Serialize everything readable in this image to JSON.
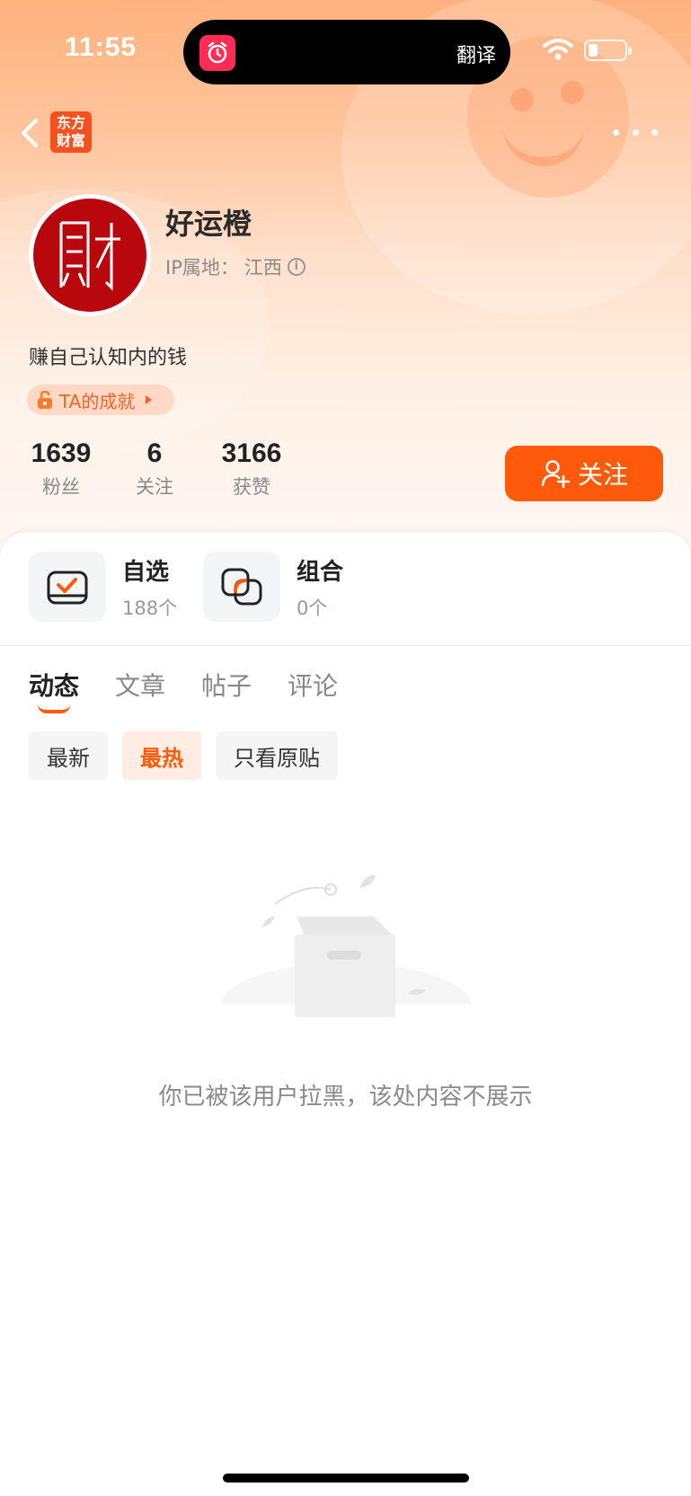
{
  "status_bar": {
    "time": "11:55",
    "island_label": "翻译"
  },
  "nav": {
    "logo_text_line1": "东方",
    "logo_text_line2": "财富"
  },
  "profile": {
    "name": "好运橙",
    "ip_label": "IP属地：",
    "ip_location": "江西",
    "bio": "赚自己认知内的钱",
    "achievement": "TA的成就"
  },
  "stats": [
    {
      "value": "1639",
      "label": "粉丝"
    },
    {
      "value": "6",
      "label": "关注"
    },
    {
      "value": "3166",
      "label": "获赞"
    }
  ],
  "follow_button": "关注",
  "features": [
    {
      "title": "自选",
      "count": "188个"
    },
    {
      "title": "组合",
      "count": "0个"
    }
  ],
  "tabs": [
    "动态",
    "文章",
    "帖子",
    "评论"
  ],
  "active_tab": "动态",
  "filters": [
    "最新",
    "最热",
    "只看原贴"
  ],
  "active_filter": "最热",
  "empty_message": "你已被该用户拉黑，该处内容不展示",
  "colors": {
    "accent": "#ff5a0a",
    "avatar_red": "#b8080e"
  }
}
